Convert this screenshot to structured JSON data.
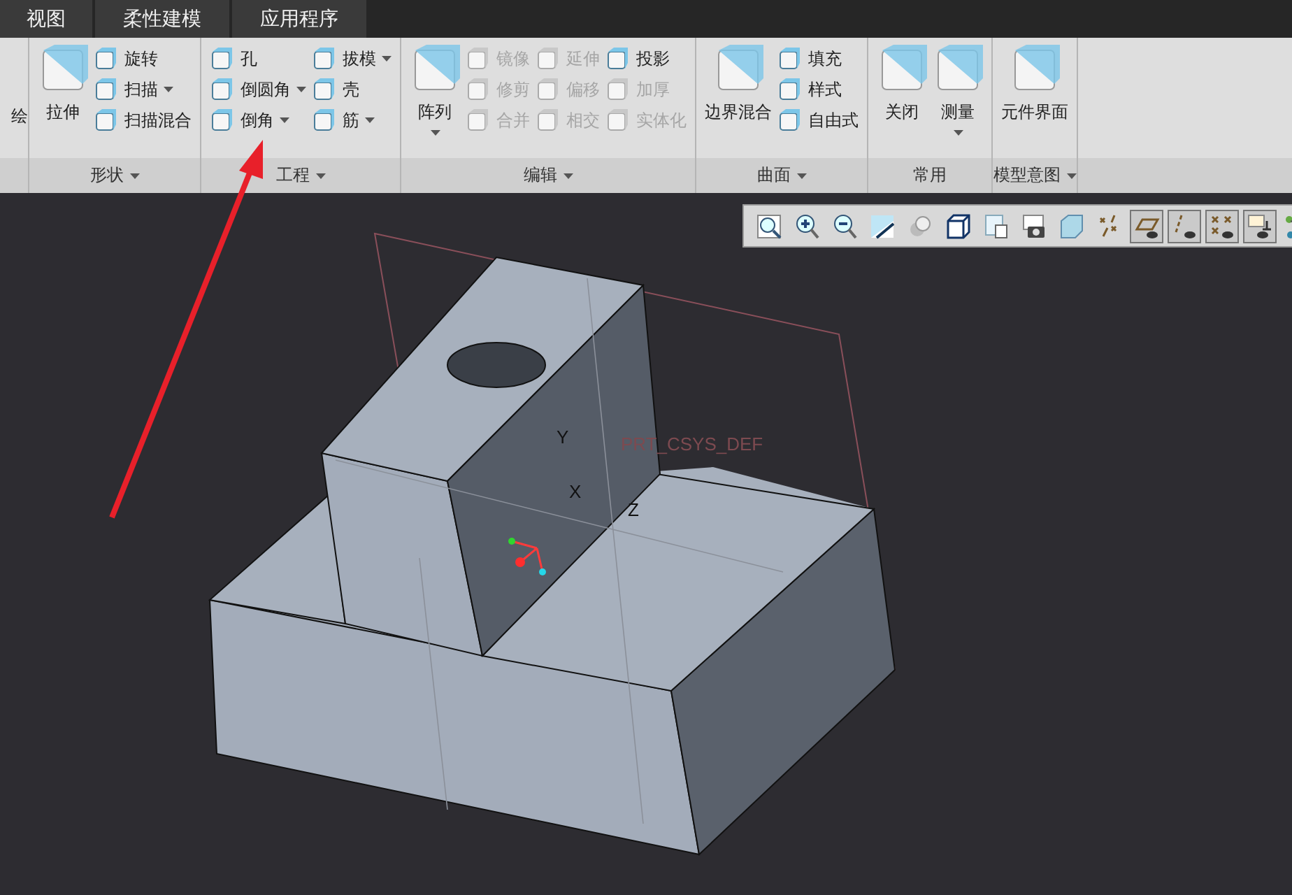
{
  "tabs": [
    {
      "label": "视图",
      "selected": false
    },
    {
      "label": "柔性建模",
      "selected": false
    },
    {
      "label": "应用程序",
      "selected": false
    }
  ],
  "ribbon": {
    "groups": [
      {
        "partial": true,
        "columns": [
          {
            "kind": "large",
            "items": [
              {
                "label": "绘",
                "dropdown": false,
                "disabled": false
              }
            ]
          }
        ]
      },
      {
        "label": "形状",
        "menu": true,
        "columns": [
          {
            "kind": "large",
            "items": [
              {
                "label": "拉伸",
                "dropdown": false,
                "disabled": false
              }
            ]
          },
          {
            "kind": "small",
            "items": [
              {
                "label": "旋转",
                "dropdown": false,
                "disabled": false
              },
              {
                "label": "扫描",
                "dropdown": true,
                "disabled": false
              },
              {
                "label": "扫描混合",
                "dropdown": false,
                "disabled": false
              }
            ]
          }
        ]
      },
      {
        "label": "工程",
        "menu": true,
        "columns": [
          {
            "kind": "small",
            "items": [
              {
                "label": "孔",
                "dropdown": false,
                "disabled": false
              },
              {
                "label": "倒圆角",
                "dropdown": true,
                "disabled": false
              },
              {
                "label": "倒角",
                "dropdown": true,
                "disabled": false
              }
            ]
          },
          {
            "kind": "small",
            "items": [
              {
                "label": "拔模",
                "dropdown": true,
                "disabled": false
              },
              {
                "label": "壳",
                "dropdown": false,
                "disabled": false
              },
              {
                "label": "筋",
                "dropdown": true,
                "disabled": false
              }
            ]
          }
        ]
      },
      {
        "label": "编辑",
        "menu": true,
        "columns": [
          {
            "kind": "large",
            "items": [
              {
                "label": "阵列",
                "dropdown": true,
                "disabled": false
              }
            ]
          },
          {
            "kind": "small",
            "items": [
              {
                "label": "镜像",
                "dropdown": false,
                "disabled": true
              },
              {
                "label": "修剪",
                "dropdown": false,
                "disabled": true
              },
              {
                "label": "合并",
                "dropdown": false,
                "disabled": true
              }
            ]
          },
          {
            "kind": "small",
            "items": [
              {
                "label": "延伸",
                "dropdown": false,
                "disabled": true
              },
              {
                "label": "偏移",
                "dropdown": false,
                "disabled": true
              },
              {
                "label": "相交",
                "dropdown": false,
                "disabled": true
              }
            ]
          },
          {
            "kind": "small",
            "items": [
              {
                "label": "投影",
                "dropdown": false,
                "disabled": false
              },
              {
                "label": "加厚",
                "dropdown": false,
                "disabled": true
              },
              {
                "label": "实体化",
                "dropdown": false,
                "disabled": true
              }
            ]
          }
        ]
      },
      {
        "label": "曲面",
        "menu": true,
        "columns": [
          {
            "kind": "large",
            "items": [
              {
                "label": "边界混合",
                "dropdown": false,
                "disabled": false
              }
            ]
          },
          {
            "kind": "small",
            "items": [
              {
                "label": "填充",
                "dropdown": false,
                "disabled": false
              },
              {
                "label": "样式",
                "dropdown": false,
                "disabled": false
              },
              {
                "label": "自由式",
                "dropdown": false,
                "disabled": false
              }
            ]
          }
        ]
      },
      {
        "label": "常用",
        "menu": false,
        "columns": [
          {
            "kind": "large",
            "items": [
              {
                "label": "关闭",
                "dropdown": false,
                "disabled": false
              }
            ]
          },
          {
            "kind": "large",
            "items": [
              {
                "label": "测量",
                "dropdown": true,
                "disabled": false
              }
            ]
          }
        ]
      },
      {
        "label": "模型意图",
        "menu": true,
        "columns": [
          {
            "kind": "large",
            "items": [
              {
                "label": "元件界面",
                "dropdown": false,
                "disabled": false
              }
            ]
          }
        ]
      }
    ]
  },
  "view_toolbar": [
    {
      "kind": "refit",
      "on": false
    },
    {
      "kind": "zoom-in",
      "on": false
    },
    {
      "kind": "zoom-out",
      "on": false
    },
    {
      "kind": "repaint",
      "on": false
    },
    {
      "kind": "style",
      "on": false
    },
    {
      "kind": "view",
      "on": false
    },
    {
      "kind": "views",
      "on": false
    },
    {
      "kind": "sections",
      "on": false
    },
    {
      "kind": "perspective",
      "on": false
    },
    {
      "kind": "datum",
      "on": false
    },
    {
      "kind": "planes",
      "on": true
    },
    {
      "kind": "axes",
      "on": true
    },
    {
      "kind": "points",
      "on": true
    },
    {
      "kind": "csys",
      "on": true
    },
    {
      "kind": "spin",
      "on": false
    }
  ],
  "viewport": {
    "labels": [
      {
        "kind": "axis",
        "text": "Y"
      },
      {
        "kind": "axis",
        "text": "X"
      },
      {
        "kind": "axis",
        "text": "Z"
      },
      {
        "kind": "csys",
        "text": "PRT_CSYS_DEF"
      }
    ]
  }
}
